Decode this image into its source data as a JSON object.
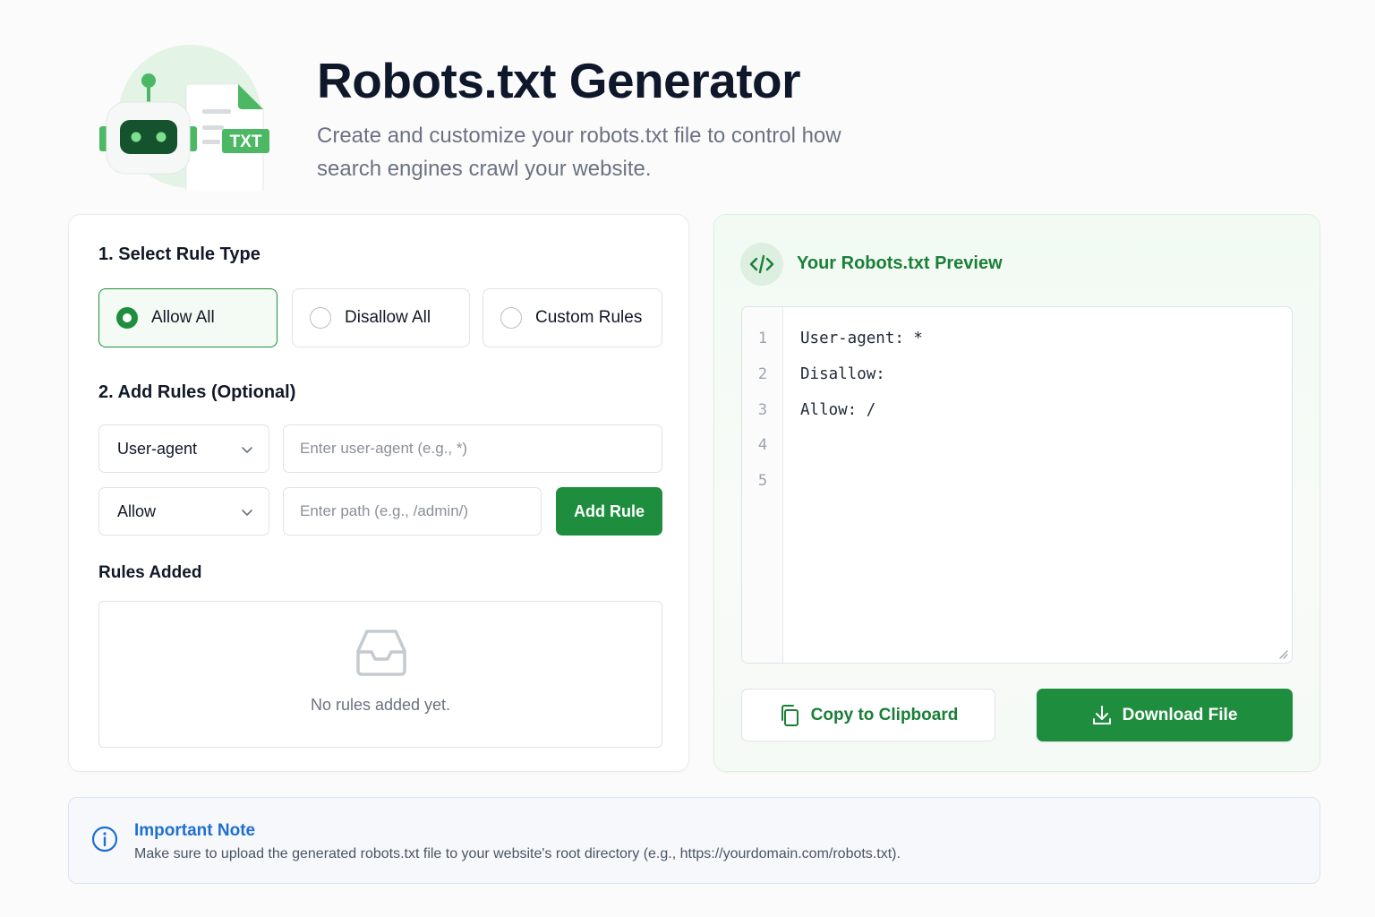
{
  "header": {
    "title": "Robots.txt Generator",
    "subtitle_line1": "Create and customize your robots.txt file to control how",
    "subtitle_line2": "search engines crawl your website.",
    "logo_text": "TXT"
  },
  "rule_type": {
    "heading": "1. Select Rule Type",
    "options": [
      {
        "label": "Allow All",
        "selected": true
      },
      {
        "label": "Disallow All",
        "selected": false
      },
      {
        "label": "Custom Rules",
        "selected": false
      }
    ]
  },
  "add_rules": {
    "heading": "2. Add Rules (Optional)",
    "field_type_select": "User-agent",
    "user_agent_placeholder": "Enter user-agent (e.g., *)",
    "directive_select": "Allow",
    "path_placeholder": "Enter path (e.g., /admin/)",
    "add_button": "Add Rule"
  },
  "rules_added": {
    "heading": "Rules Added",
    "empty_text": "No rules added yet."
  },
  "preview": {
    "title": "Your Robots.txt Preview",
    "line_numbers": [
      "1",
      "2",
      "3",
      "4",
      "5"
    ],
    "lines": [
      "User-agent: *",
      "Disallow:",
      "Allow: /",
      "",
      ""
    ],
    "copy_button": "Copy to Clipboard",
    "download_button": "Download File"
  },
  "note": {
    "title": "Important Note",
    "text": "Make sure to upload the generated robots.txt file to your website's root directory (e.g., https://yourdomain.com/robots.txt)."
  },
  "colors": {
    "primary_green": "#1e8e3e",
    "note_blue": "#1f6fd1"
  },
  "icons": [
    "robot-logo-icon",
    "txt-file-icon",
    "chevron-down-icon",
    "inbox-icon",
    "code-icon",
    "copy-icon",
    "download-icon",
    "info-icon"
  ]
}
